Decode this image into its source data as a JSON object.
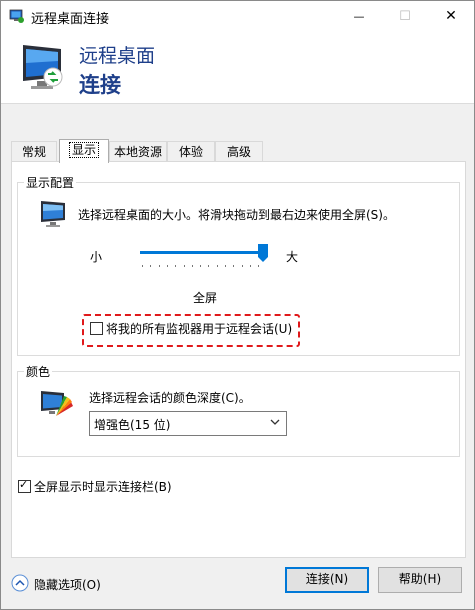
{
  "window": {
    "title": "远程桌面连接",
    "minimize_glyph": "—",
    "maximize_glyph": "☐",
    "close_glyph": "✕"
  },
  "header": {
    "line1": "远程桌面",
    "line2": "连接"
  },
  "tabs": [
    {
      "label": "常规",
      "active": false
    },
    {
      "label": "显示",
      "active": true
    },
    {
      "label": "本地资源",
      "active": false
    },
    {
      "label": "体验",
      "active": false
    },
    {
      "label": "高级",
      "active": false
    }
  ],
  "display_config": {
    "legend": "显示配置",
    "description": "选择远程桌面的大小。将滑块拖动到最右边来使用全屏(S)。",
    "slider_min_label": "小",
    "slider_max_label": "大",
    "slider_value_fraction": 1.0,
    "size_label": "全屏",
    "all_monitors_label": "将我的所有监视器用于远程会话(U)",
    "all_monitors_checked": false
  },
  "colors": {
    "legend": "颜色",
    "description": "选择远程会话的颜色深度(C)。",
    "depth_selected": "增强色(15 位)"
  },
  "connection_bar": {
    "label": "全屏显示时显示连接栏(B)",
    "checked": true
  },
  "footer": {
    "hide_options_label": "隐藏选项(O)",
    "connect_label": "连接(N)",
    "help_label": "帮助(H)"
  },
  "accent_colors": {
    "title_blue": "#1e3f8a",
    "highlight_red": "#e0191b",
    "slider_blue": "#0078d7"
  }
}
